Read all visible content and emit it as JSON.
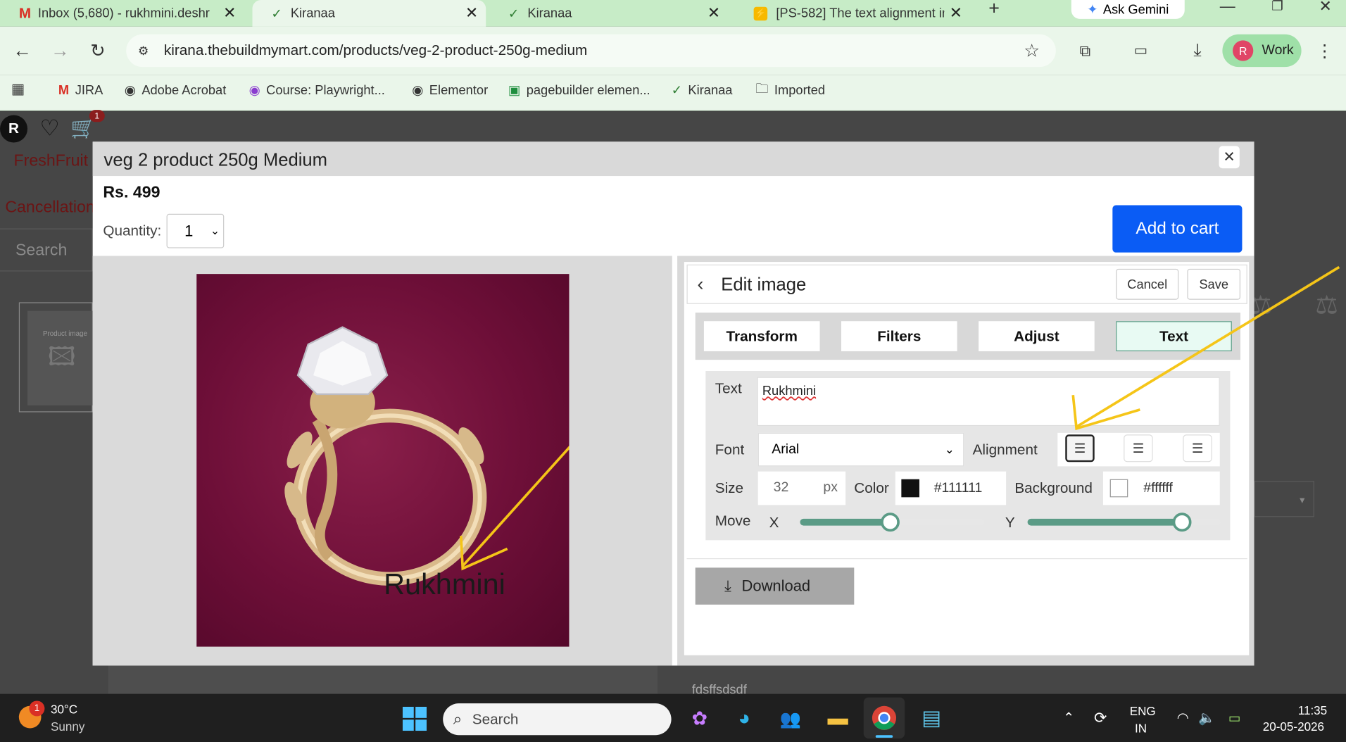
{
  "browser": {
    "tabs": [
      {
        "label": "Inbox (5,680) - rukhmini.deshr",
        "icon": "gmail-icon"
      },
      {
        "label": "Kiranaa",
        "icon": "check-circle-icon"
      },
      {
        "label": "Kiranaa",
        "icon": "check-circle-icon"
      },
      {
        "label": "[PS-582] The text alignment ir",
        "icon": "bolt-icon"
      }
    ],
    "new_tab": "+",
    "gemini": "Ask Gemini",
    "url": "kirana.thebuildmymart.com/products/veg-2-product-250g-medium",
    "profile_initial": "R",
    "profile_label": "Work",
    "bookmarks": [
      "JIRA",
      "Adobe Acrobat",
      "Course: Playwright...",
      "Elementor",
      "pagebuilder elemen...",
      "Kiranaa",
      "Imported"
    ]
  },
  "background_page": {
    "avatar": "R",
    "cart_count": "1",
    "brand": "FreshFruit",
    "cancellation": "Cancellation",
    "search": "Search",
    "product_image_label": "Product image",
    "snippet": "fdsffsdsdf"
  },
  "modal": {
    "title": "veg 2 product 250g Medium",
    "price": "Rs. 499",
    "quantity_label": "Quantity:",
    "quantity_value": "1",
    "add_to_cart": "Add to cart",
    "preview_text": "Rukhmini"
  },
  "editor": {
    "title": "Edit image",
    "cancel": "Cancel",
    "save": "Save",
    "tabs": [
      "Transform",
      "Filters",
      "Adjust",
      "Text"
    ],
    "active_tab": "Text",
    "text_label": "Text",
    "text_value": "Rukhmini",
    "font_label": "Font",
    "font_value": "Arial",
    "alignment_label": "Alignment",
    "size_label": "Size",
    "size_value": "32",
    "size_unit": "px",
    "color_label": "Color",
    "color_value": "#111111",
    "background_label": "Background",
    "background_value": "#ffffff",
    "move_label": "Move",
    "x_label": "X",
    "y_label": "Y",
    "move_x_fraction": 0.49,
    "move_y_fraction": 0.8,
    "download": "Download",
    "accent": "#5b9b86"
  },
  "taskbar": {
    "weather_temp": "30°C",
    "weather_desc": "Sunny",
    "weather_badge": "1",
    "search": "Search",
    "lang1": "ENG",
    "lang2": "IN",
    "time": "11:35",
    "date": "20-05-2026"
  }
}
